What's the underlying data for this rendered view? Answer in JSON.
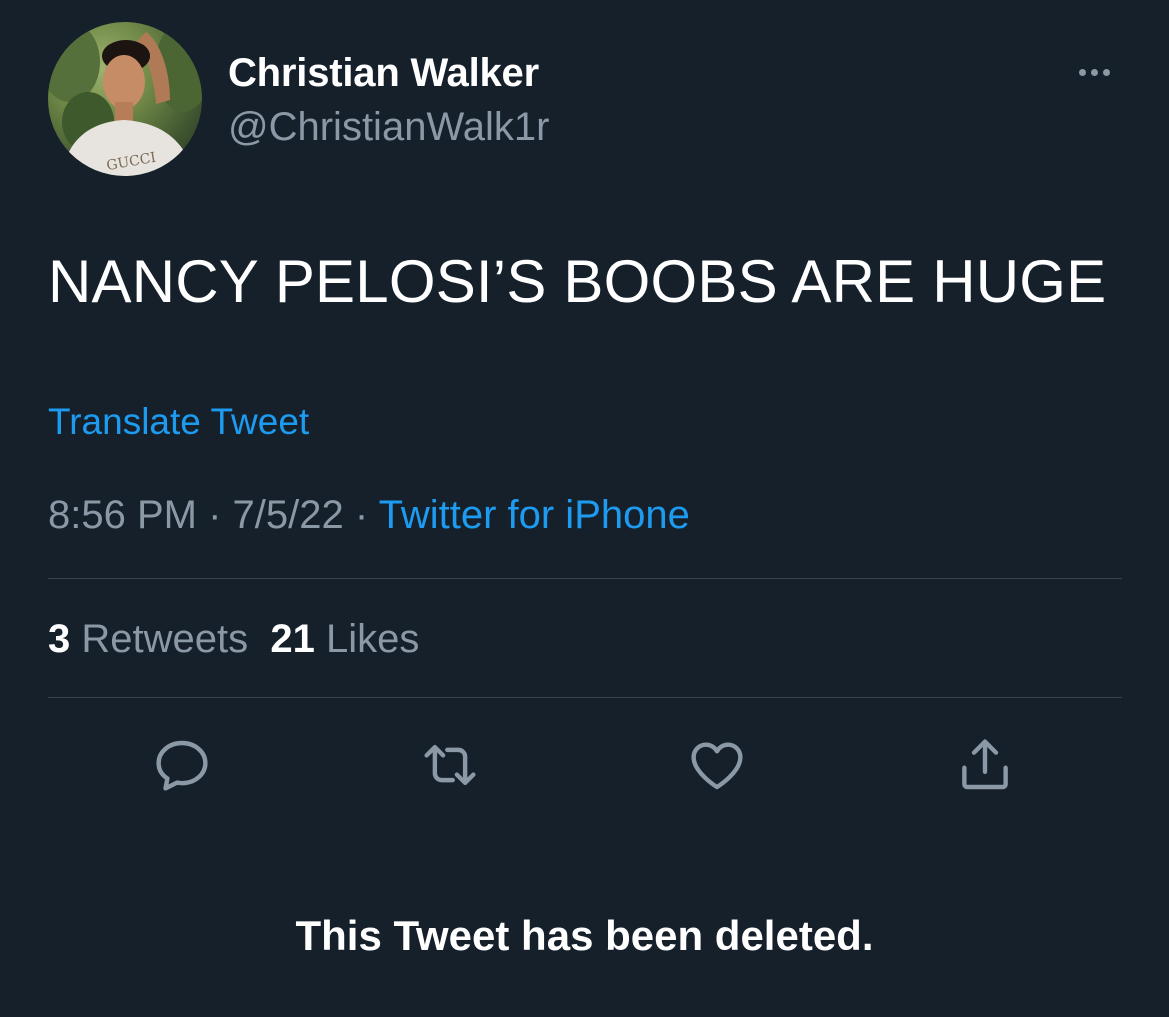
{
  "author": {
    "display_name": "Christian Walker",
    "handle": "@ChristianWalk1r",
    "avatar_shirt_text": "GUCCI"
  },
  "tweet": {
    "text": "NANCY PELOSI’S BOOBS ARE HUGE",
    "translate_label": "Translate Tweet",
    "time": "8:56 PM",
    "separator": "·",
    "date": "7/5/22",
    "source": "Twitter for iPhone"
  },
  "stats": {
    "retweets_count": "3",
    "retweets_label": "Retweets",
    "likes_count": "21",
    "likes_label": "Likes"
  },
  "actions": {
    "reply_icon": "reply-bubble-icon",
    "retweet_icon": "retweet-arrows-icon",
    "like_icon": "heart-icon",
    "share_icon": "share-upload-icon"
  },
  "notice": "This Tweet has been deleted.",
  "colors": {
    "background": "#15202b",
    "text_primary": "#ffffff",
    "text_secondary": "#8b98a5",
    "accent": "#1d9bf0",
    "divider": "#38444d"
  }
}
